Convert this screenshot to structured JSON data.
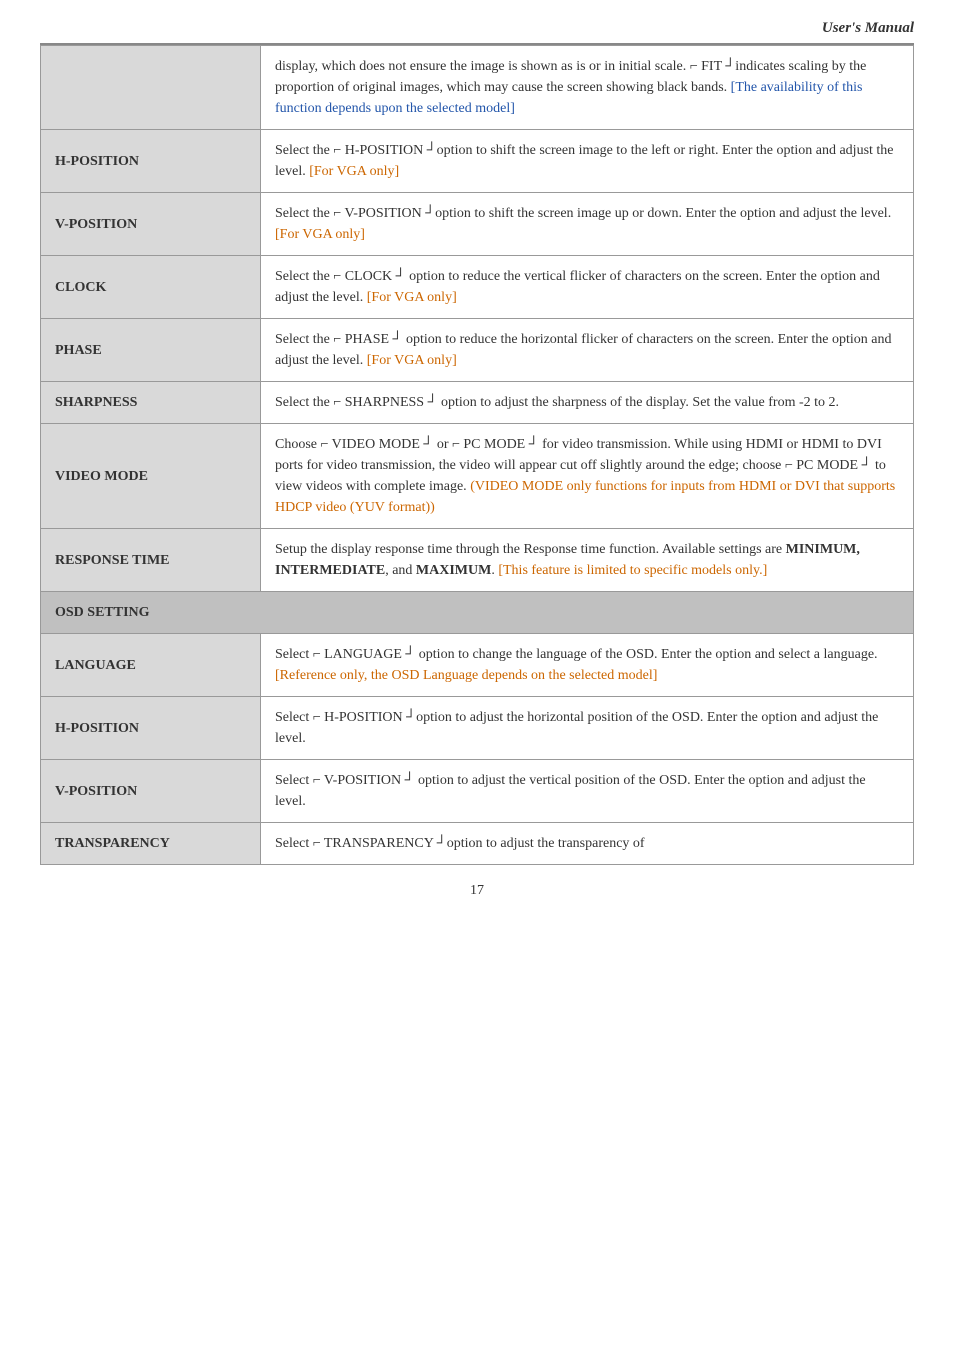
{
  "header": {
    "title": "User's Manual"
  },
  "rows": [
    {
      "label": "",
      "content_parts": [
        {
          "text": "display, which does not ensure the image is shown as is or in initial scale. ⌐ FIT ┘indicates scaling by the proportion of original images, which may cause the screen showing black bands. ",
          "type": "normal"
        },
        {
          "text": "[The availability of this function depends upon the selected model]",
          "type": "blue"
        }
      ]
    },
    {
      "label": "H-POSITION",
      "content_parts": [
        {
          "text": "Select the ⌐ H-POSITION ┘option to shift the screen image to the left or right. Enter the option and adjust the level. ",
          "type": "normal"
        },
        {
          "text": "[For VGA only]",
          "type": "orange"
        }
      ]
    },
    {
      "label": "V-POSITION",
      "content_parts": [
        {
          "text": "Select the ⌐ V-POSITION ┘option to shift the screen image up or down. Enter the option and adjust the level. ",
          "type": "normal"
        },
        {
          "text": "[For VGA only]",
          "type": "orange"
        }
      ]
    },
    {
      "label": "CLOCK",
      "content_parts": [
        {
          "text": "Select the ⌐ CLOCK ┘ option to reduce the vertical flicker of characters on the screen. Enter the option and adjust the level. ",
          "type": "normal"
        },
        {
          "text": "[For VGA only]",
          "type": "orange"
        }
      ]
    },
    {
      "label": "PHASE",
      "content_parts": [
        {
          "text": "Select the ⌐ PHASE ┘ option to reduce the horizontal flicker of characters on the screen. Enter the option and adjust the level. ",
          "type": "normal"
        },
        {
          "text": "[For VGA only]",
          "type": "orange"
        }
      ]
    },
    {
      "label": "SHARPNESS",
      "content_parts": [
        {
          "text": "Select the ⌐ SHARPNESS ┘ option to adjust the sharpness of the display. Set the value from -2 to 2.",
          "type": "normal"
        }
      ]
    },
    {
      "label": "VIDEO MODE",
      "content_parts": [
        {
          "text": "Choose ⌐ VIDEO MODE ┘ or ⌐ PC MODE ┘ for video transmission. While using HDMI or HDMI to DVI ports for video transmission, the video will appear cut off slightly around the edge; choose ⌐ PC MODE ┘ to view videos with complete image. ",
          "type": "normal"
        },
        {
          "text": "(VIDEO MODE only functions for inputs from HDMI or DVI that supports HDCP video (YUV format))",
          "type": "orange"
        }
      ]
    },
    {
      "label": "RESPONSE TIME",
      "content_parts": [
        {
          "text": "Setup the display response time through the Response time function. Available settings are ",
          "type": "normal"
        },
        {
          "text": "MINIMUM,",
          "type": "bold"
        },
        {
          "text": "\nINTERMEDIATE",
          "type": "bold"
        },
        {
          "text": ", and ",
          "type": "normal"
        },
        {
          "text": "MAXIMUM",
          "type": "bold"
        },
        {
          "text": ". ",
          "type": "normal"
        },
        {
          "text": "[This feature is limited to specific models only.]",
          "type": "orange"
        }
      ]
    },
    {
      "label": "OSD SETTING",
      "is_section": true
    },
    {
      "label": "LANGUAGE",
      "content_parts": [
        {
          "text": "Select ⌐ LANGUAGE ┘  option to change the language of the OSD. Enter the option and select a language. ",
          "type": "normal"
        },
        {
          "text": "[Reference only, the OSD Language depends on the selected model]",
          "type": "orange"
        }
      ]
    },
    {
      "label": "H-POSITION",
      "content_parts": [
        {
          "text": "Select ⌐ H-POSITION ┘option to adjust the horizontal position of the OSD. Enter the option and adjust the level.",
          "type": "normal"
        }
      ]
    },
    {
      "label": "V-POSITION",
      "content_parts": [
        {
          "text": "Select ⌐ V-POSITION ┘ option to adjust the vertical position of the OSD. Enter the option and adjust the level.",
          "type": "normal"
        }
      ]
    },
    {
      "label": "TRANSPARENCY",
      "content_parts": [
        {
          "text": "Select ⌐ TRANSPARENCY ┘option to adjust the transparency of",
          "type": "normal"
        }
      ]
    }
  ],
  "page_number": "17"
}
